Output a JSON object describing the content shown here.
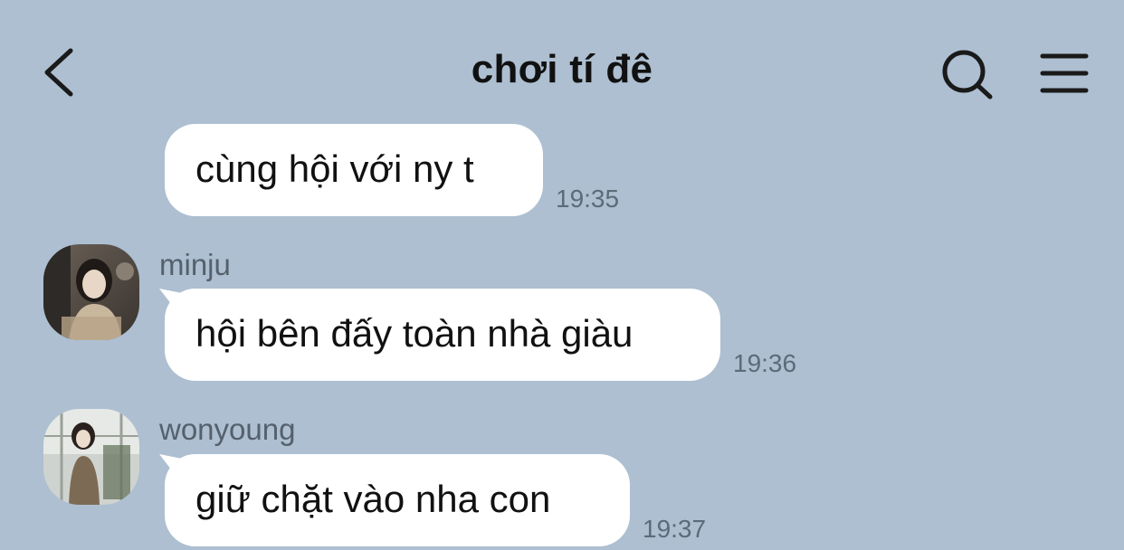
{
  "header": {
    "title": "chơi tí đê",
    "back_icon": "chevron-left-icon",
    "search_icon": "search-icon",
    "menu_icon": "hamburger-menu-icon"
  },
  "messages": [
    {
      "sender": "",
      "text": "cùng hội với ny t",
      "time": "19:35"
    },
    {
      "sender": "minju",
      "text": "hội bên đấy toàn nhà giàu",
      "time": "19:36"
    },
    {
      "sender": "wonyoung",
      "text": "giữ chặt vào nha con",
      "time": "19:37"
    }
  ],
  "colors": {
    "background": "#adbfd1",
    "bubble": "#ffffff",
    "timestamp": "#5d6b79"
  }
}
